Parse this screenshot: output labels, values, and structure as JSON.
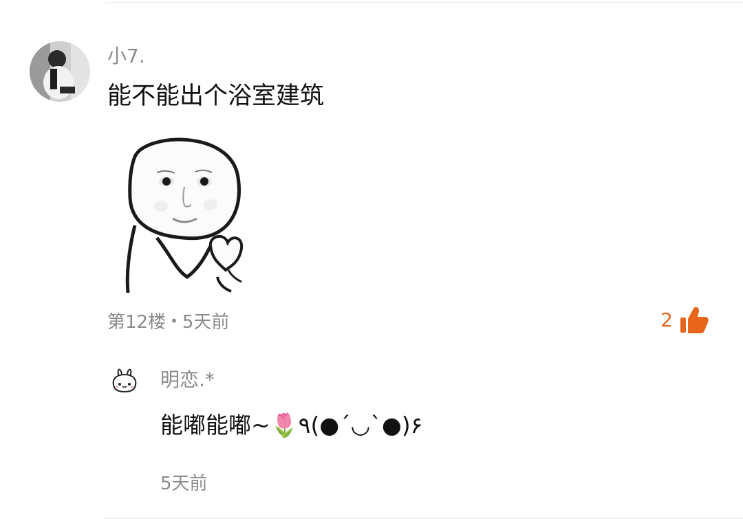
{
  "comment": {
    "username": "小7.",
    "text": "能不能出个浴室建筑",
    "floor": "第12楼",
    "separator": "•",
    "time": "5天前",
    "likes": "2",
    "sticker": "meme-face-sticker"
  },
  "reply": {
    "username": "明恋.*",
    "text": "能嘟能嘟~🌷٩(●´◡`●)۶",
    "time": "5天前"
  },
  "colors": {
    "like_accent": "#e8651c",
    "meta_gray": "#8a8a8a",
    "text_dark": "#111111"
  },
  "icons": {
    "like": "thumbs-up-icon"
  }
}
